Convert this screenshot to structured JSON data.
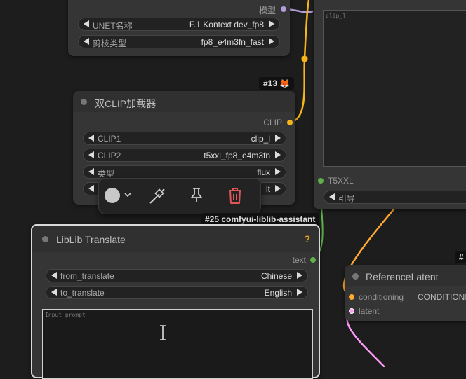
{
  "colors": {
    "canvas": "#1d1d1d",
    "node_bg": "#353535",
    "clip_wire": "#f5b518",
    "latent_wire": "#ff9cf9",
    "model_wire": "#b39ddb",
    "conditioning_wire": "#ffa931",
    "delete_red": "#e05555",
    "help_orange": "#f0a020",
    "green_status": "#5fb04a"
  },
  "unet_node": {
    "output_label": "模型",
    "widgets": [
      {
        "label": "UNET名称",
        "value": "F.1 Kontext dev_fp8"
      },
      {
        "label": "剪枝类型",
        "value": "fp8_e4m3fn_fast"
      }
    ]
  },
  "text_encoder_node": {
    "textarea_value": "clip_l",
    "input_label": "T5XXL",
    "widget_label": "引导"
  },
  "dual_clip_node": {
    "badge": "#13",
    "badge_icon": "fox-icon",
    "title": "双CLIP加载器",
    "output_label": "CLIP",
    "widgets": [
      {
        "label": "CLIP1",
        "value": "clip_l"
      },
      {
        "label": "CLIP2",
        "value": "t5xxl_fp8_e4m3fn"
      },
      {
        "label": "类型",
        "value": "flux"
      },
      {
        "label": "",
        "value": "lt"
      }
    ]
  },
  "selection_toolbar": {
    "color_icon": "color-circle-icon",
    "dropdown_icon": "chevron-down-icon",
    "bypass_icon": "bypass-icon",
    "pin_icon": "pin-icon",
    "delete_icon": "trash-icon"
  },
  "liblib_node": {
    "badge": "#25 comfyui-liblib-assistant",
    "title": "LibLib Translate",
    "help": "?",
    "output_label": "text",
    "widgets": [
      {
        "label": "from_translate",
        "value": "Chinese"
      },
      {
        "label": "to_translate",
        "value": "English"
      }
    ],
    "textarea_placeholder": "Input prompt"
  },
  "reference_node": {
    "badge": "#",
    "title": "ReferenceLatent",
    "inputs": [
      {
        "label": "conditioning",
        "output": "CONDITIONI"
      },
      {
        "label": "latent"
      }
    ]
  }
}
